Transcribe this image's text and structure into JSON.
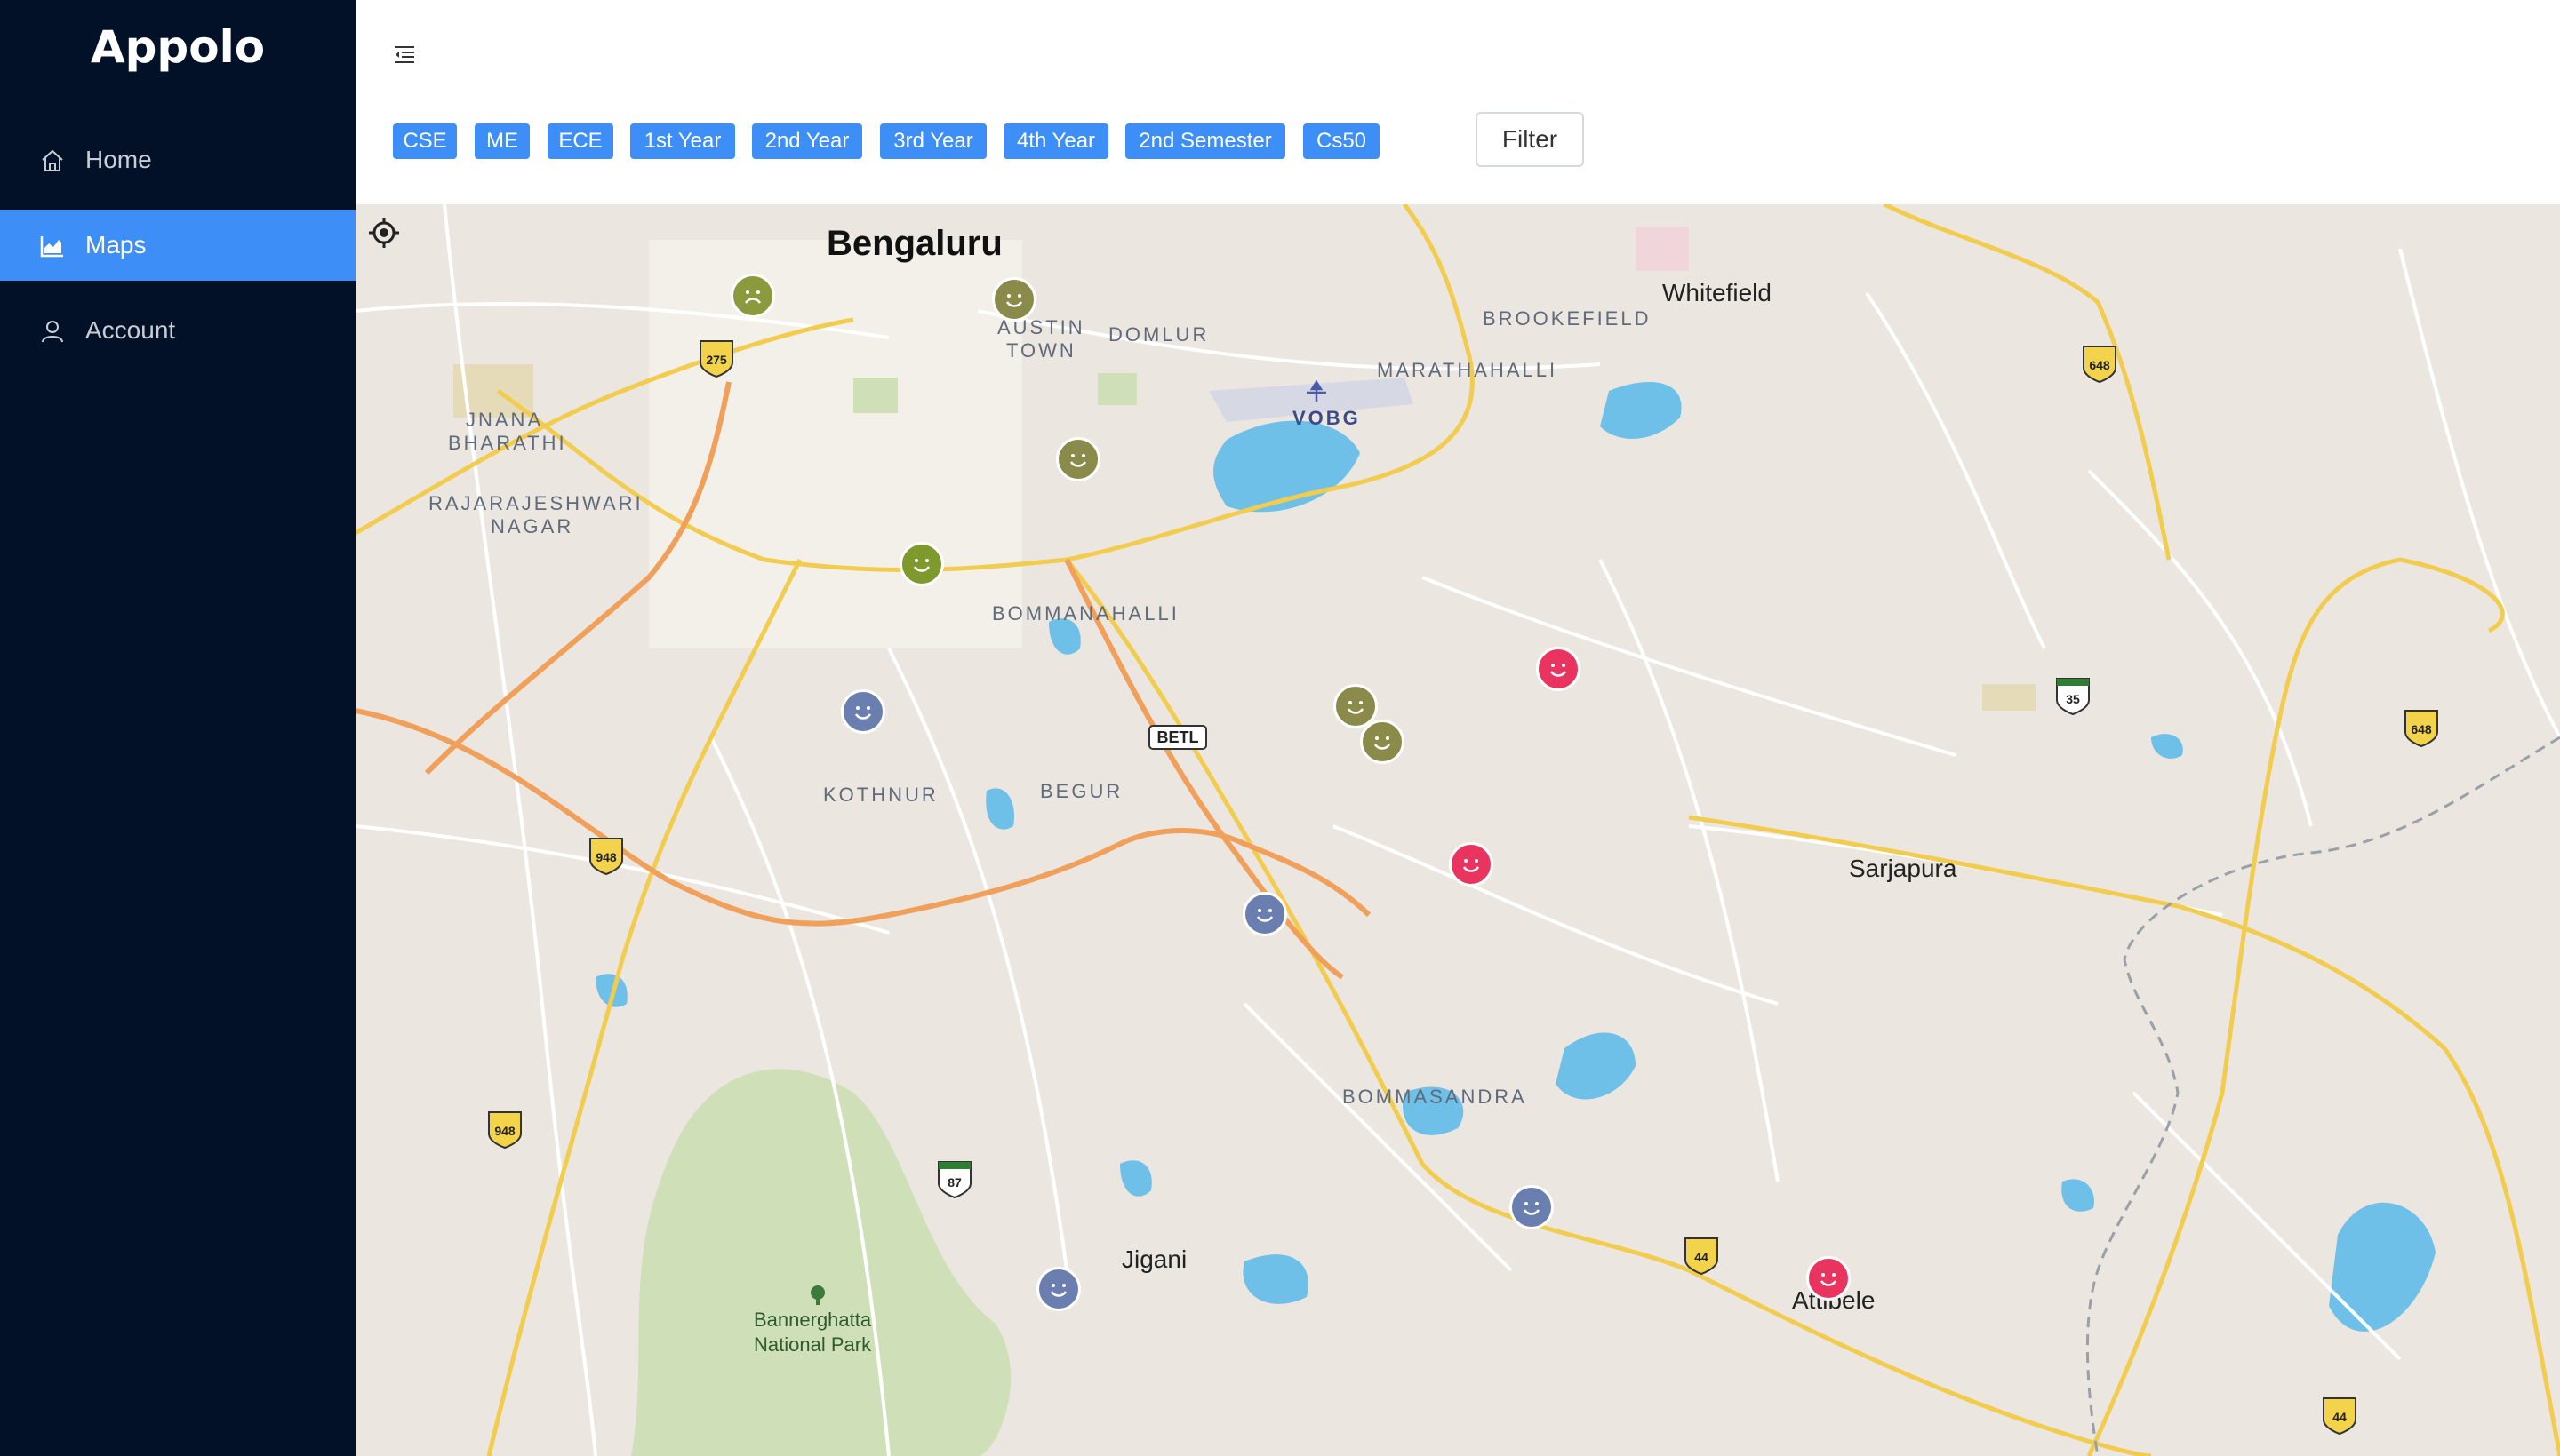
{
  "app": {
    "title": "Appolo"
  },
  "sidebar": {
    "items": [
      {
        "label": "Home",
        "icon": "home-icon",
        "active": false
      },
      {
        "label": "Maps",
        "icon": "chart-icon",
        "active": true
      },
      {
        "label": "Account",
        "icon": "user-icon",
        "active": false
      }
    ]
  },
  "header": {
    "filters": [
      "CSE",
      "ME",
      "ECE",
      "1st Year",
      "2nd Year",
      "3rd Year",
      "4th Year",
      "2nd Semester",
      "Cs50"
    ],
    "filter_button": "Filter"
  },
  "map": {
    "labels": {
      "bengaluru": "Bengaluru",
      "austin_town_1": "AUSTIN",
      "austin_town_2": "TOWN",
      "domlur": "DOMLUR",
      "brookefield": "BROOKEFIELD",
      "whitefield": "Whitefield",
      "marathahalli": "MARATHAHALLI",
      "vobg": "VOBG",
      "jnana_1": "JNANA",
      "jnana_2": "BHARATHI",
      "rr_1": "RAJARAJESHWARI",
      "rr_2": "NAGAR",
      "bommanahalli": "BOMMANAHALLI",
      "kothnur": "KOTHNUR",
      "begur": "BEGUR",
      "betl": "BETL",
      "sarjapura": "Sarjapura",
      "bommasandra": "BOMMASANDRA",
      "jigani": "Jigani",
      "attibele": "Attibele",
      "park_1": "Bannerghatta",
      "park_2": "National Park"
    },
    "shields": [
      "275",
      "648",
      "35",
      "648",
      "948",
      "948",
      "87",
      "44",
      "44"
    ],
    "markers": [
      {
        "mood": "sad",
        "color": "#8a9a3c"
      },
      {
        "mood": "happy",
        "color": "#8a8a4a"
      },
      {
        "mood": "happy",
        "color": "#8a8a4a"
      },
      {
        "mood": "happy",
        "color": "#7f9a2c"
      },
      {
        "mood": "happy",
        "color": "#6a7fb0"
      },
      {
        "mood": "happy",
        "color": "#8a8a4a"
      },
      {
        "mood": "happy",
        "color": "#8a8a4a"
      },
      {
        "mood": "happy",
        "color": "#e8345f"
      },
      {
        "mood": "happy",
        "color": "#e8345f"
      },
      {
        "mood": "happy",
        "color": "#6a7fb0"
      },
      {
        "mood": "happy",
        "color": "#6a7fb0"
      },
      {
        "mood": "happy",
        "color": "#6a7fb0"
      },
      {
        "mood": "happy",
        "color": "#e8345f"
      }
    ]
  }
}
